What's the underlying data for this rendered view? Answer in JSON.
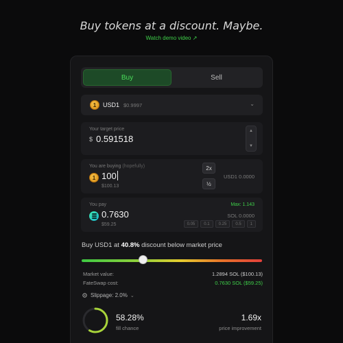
{
  "hero": {
    "title": "Buy tokens at a discount. Maybe.",
    "demo_link": "Watch demo video ↗"
  },
  "tabs": [
    {
      "label": "Buy",
      "active": true
    },
    {
      "label": "Sell",
      "active": false
    }
  ],
  "token": {
    "symbol": "USD1",
    "price": "$0.9997",
    "icon": "usd1-coin-icon"
  },
  "target_price": {
    "label": "Your target price",
    "currency": "$",
    "value": "0.591518"
  },
  "buying": {
    "label": "You are buying",
    "label_hint": "(hopefully)",
    "value": "100",
    "usd_value": "$100.13",
    "btn_double": "2x",
    "btn_half": "½",
    "balance": "USD1 0.0000"
  },
  "pay": {
    "label": "You pay",
    "max": "Max: 1.143",
    "value": "0.7630",
    "usd_value": "$59.25",
    "balance": "SOL 0.0000",
    "chips": [
      "0.05",
      "0.1",
      "0.25",
      "0.5",
      "1"
    ]
  },
  "discount": {
    "prefix": "Buy USD1 at",
    "pct": "40.8%",
    "suffix": "discount below market price",
    "slider_fraction": 0.34
  },
  "summary": {
    "market_label": "Market value:",
    "market_value": "1.2894 SOL ($100.13)",
    "cost_label": "FateSwap cost:",
    "cost_value": "0.7630 SOL ($59.25)"
  },
  "slippage": {
    "label": "Slippage: 2.0%"
  },
  "stats": {
    "fill_pct": "58.28%",
    "fill_label": "fill chance",
    "fill_fraction": 0.5828,
    "improvement": "1.69x",
    "improvement_label": "price improvement"
  },
  "colors": {
    "accent_green": "#3fd14a",
    "background": "#0b0b0c",
    "card": "#151517"
  }
}
